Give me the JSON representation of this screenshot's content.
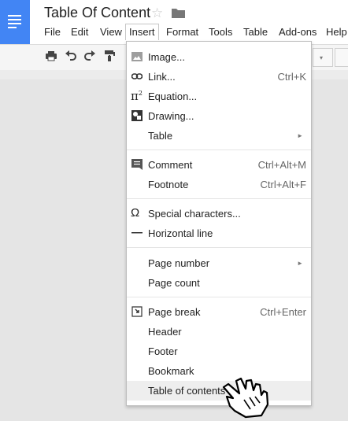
{
  "app": {
    "doc_title": "Table Of Content"
  },
  "menubar": [
    {
      "label": "File"
    },
    {
      "label": "Edit"
    },
    {
      "label": "View"
    },
    {
      "label": "Insert"
    },
    {
      "label": "Format"
    },
    {
      "label": "Tools"
    },
    {
      "label": "Table"
    },
    {
      "label": "Add-ons"
    },
    {
      "label": "Help"
    }
  ],
  "insert_menu": {
    "items": [
      {
        "label": "Image...",
        "icon": "image-icon"
      },
      {
        "label": "Link...",
        "shortcut": "Ctrl+K",
        "icon": "link-icon"
      },
      {
        "label": "Equation...",
        "icon": "pi-icon"
      },
      {
        "label": "Drawing...",
        "icon": "drawing-icon"
      },
      {
        "label": "Table",
        "submenu": true
      },
      {
        "label": "Comment",
        "shortcut": "Ctrl+Alt+M",
        "icon": "comment-icon"
      },
      {
        "label": "Footnote",
        "shortcut": "Ctrl+Alt+F"
      },
      {
        "label": "Special characters...",
        "icon": "omega-icon"
      },
      {
        "label": "Horizontal line",
        "icon": "horizontal-line-icon"
      },
      {
        "label": "Page number",
        "submenu": true
      },
      {
        "label": "Page count"
      },
      {
        "label": "Page break",
        "shortcut": "Ctrl+Enter",
        "icon": "page-break-icon"
      },
      {
        "label": "Header"
      },
      {
        "label": "Footer"
      },
      {
        "label": "Bookmark"
      },
      {
        "label": "Table of contents",
        "highlighted": true
      }
    ],
    "submenu_arrow": "►"
  },
  "icons": {
    "star": "☆",
    "pi_glyph": "π",
    "pi_sup": "2",
    "omega_glyph": "Ω",
    "dropdown_arrow": "▾"
  },
  "colors": {
    "brand_blue": "#4285f4",
    "highlight": "#eeeeee"
  }
}
